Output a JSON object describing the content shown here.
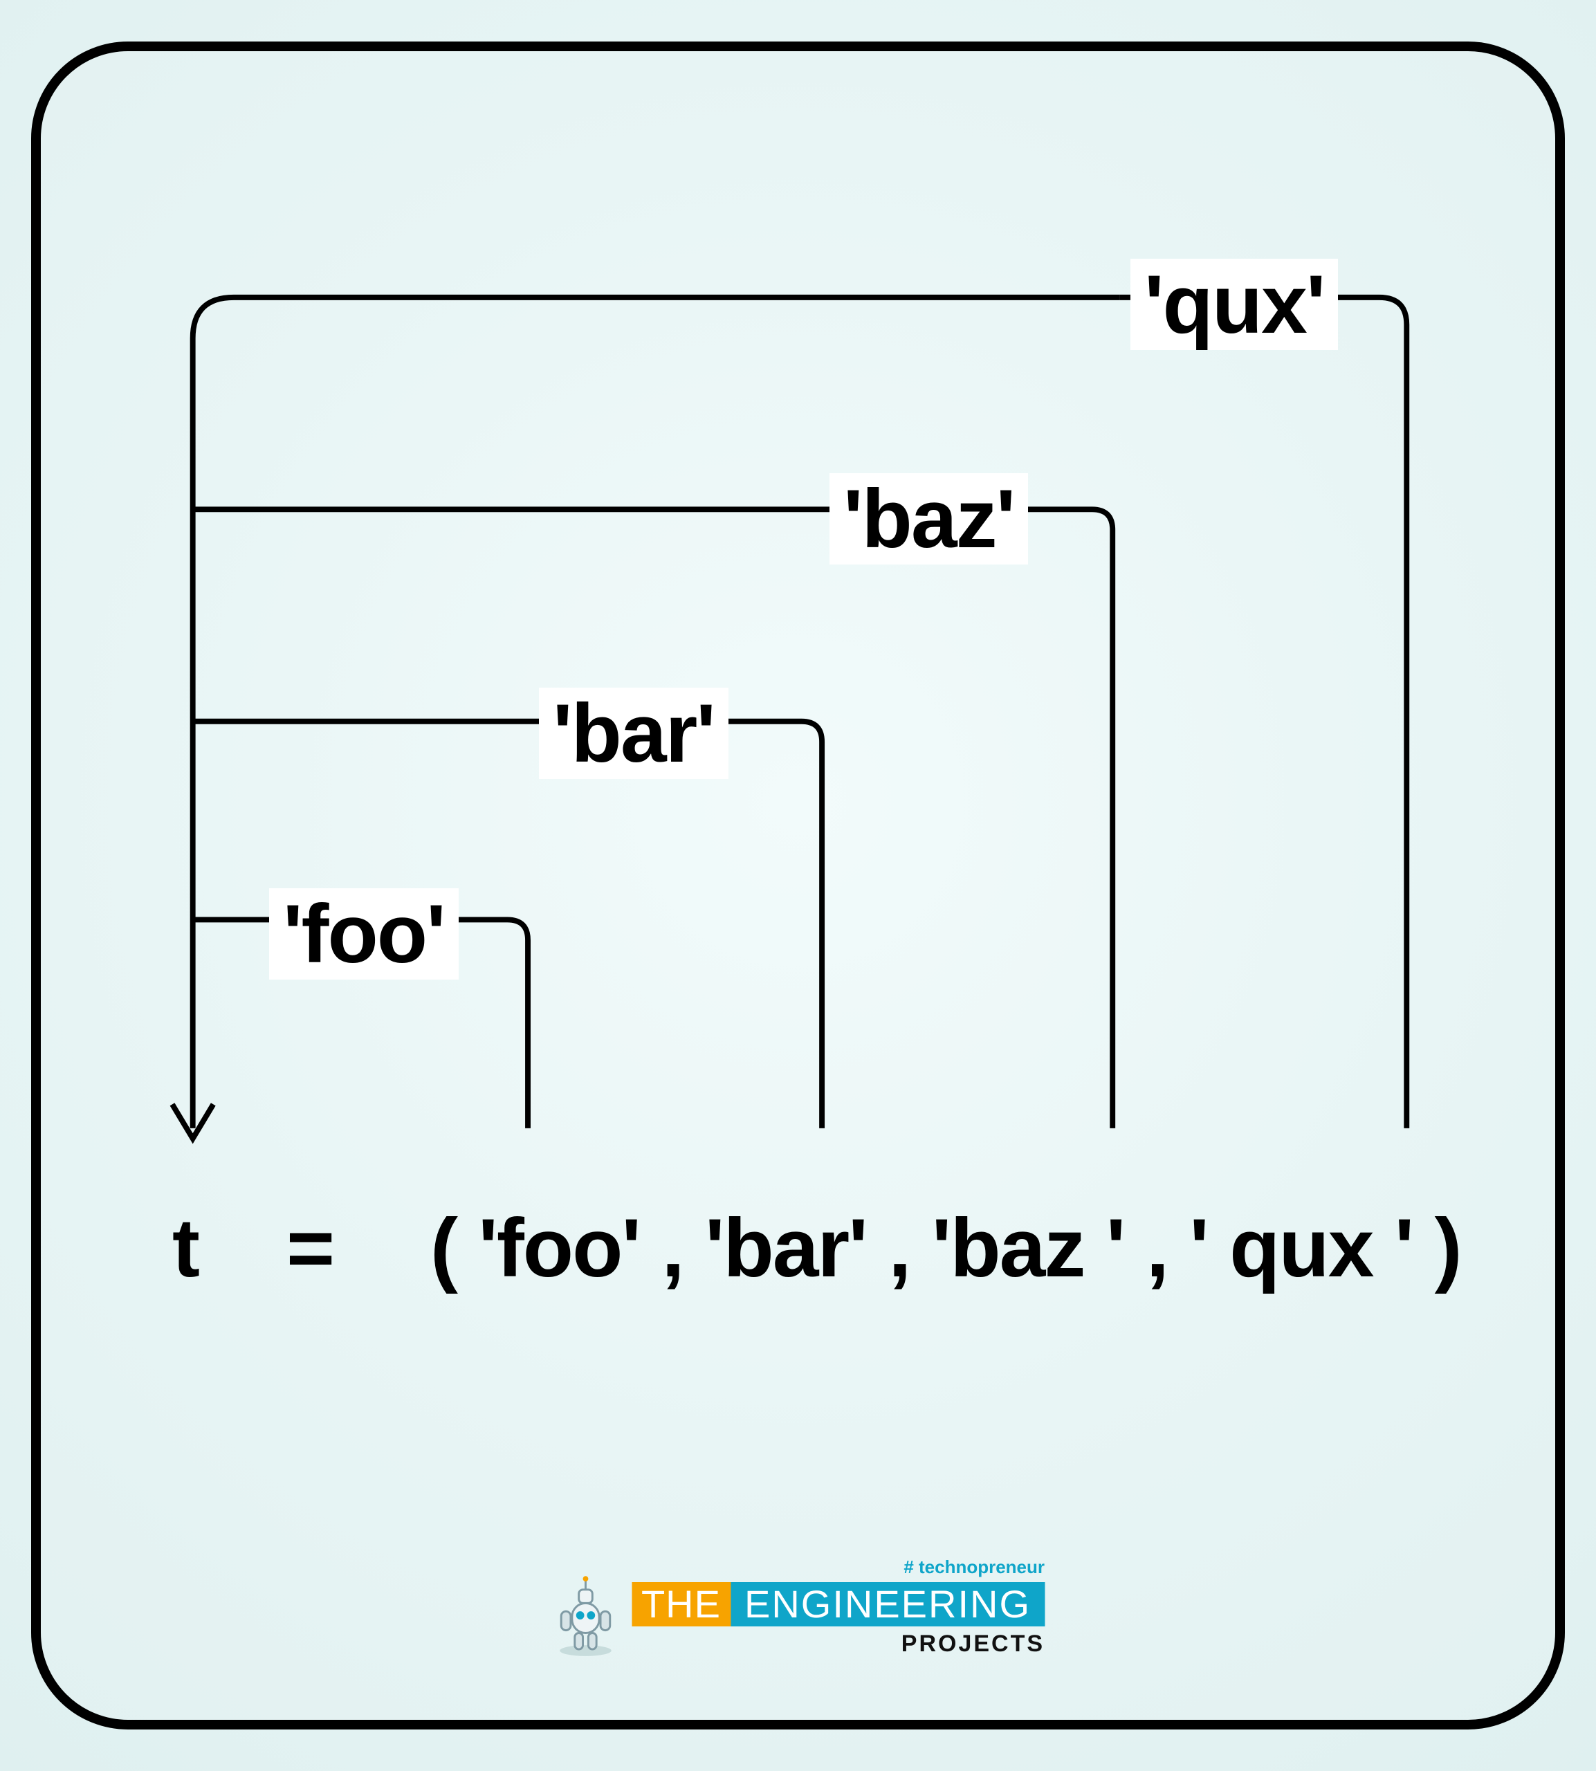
{
  "diagram": {
    "items": [
      {
        "label": "'foo'"
      },
      {
        "label": "'bar'"
      },
      {
        "label": "'baz'"
      },
      {
        "label": "'qux'"
      }
    ],
    "variable": "t",
    "equals": "=",
    "expression": "( 'foo' ,  'bar' , 'baz ' , '  qux ' )"
  },
  "footer": {
    "tag": "# technopreneur",
    "the": "THE",
    "eng": "ENGINEERING",
    "proj": "PROJECTS"
  }
}
